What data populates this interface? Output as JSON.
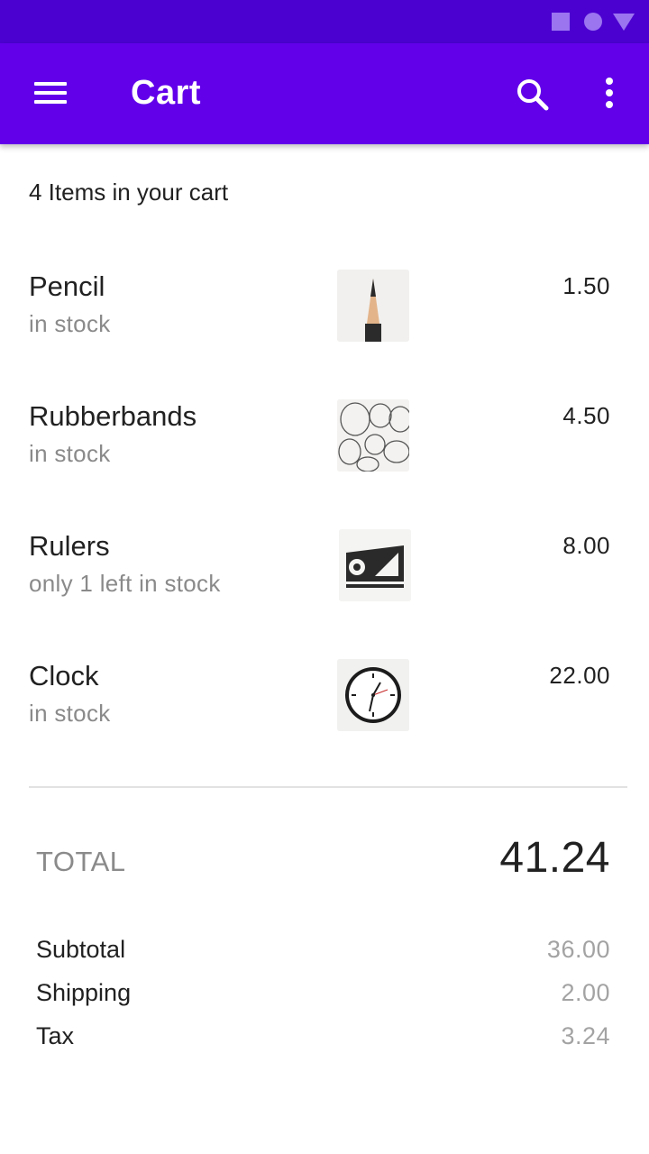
{
  "colors": {
    "status_bar": "#4b02d0",
    "app_bar": "#6200ea",
    "status_icons": "#9b74f0",
    "secondary_text": "#8a8a8a"
  },
  "app_bar": {
    "title": "Cart",
    "icons": [
      "menu-icon",
      "search-icon",
      "more-vert-icon"
    ]
  },
  "cart": {
    "count_text": "4 Items in your cart",
    "items": [
      {
        "name": "Pencil",
        "status": "in stock",
        "price": "1.50",
        "thumb": "pencil-image"
      },
      {
        "name": "Rubberbands",
        "status": "in stock",
        "price": "4.50",
        "thumb": "rubberbands-image"
      },
      {
        "name": "Rulers",
        "status": "only 1 left in stock",
        "price": "8.00",
        "thumb": "rulers-image"
      },
      {
        "name": "Clock",
        "status": "in stock",
        "price": "22.00",
        "thumb": "clock-image"
      }
    ]
  },
  "summary": {
    "total_label": "TOTAL",
    "total_value": "41.24",
    "rows": [
      {
        "label": "Subtotal",
        "value": "36.00"
      },
      {
        "label": "Shipping",
        "value": "2.00"
      },
      {
        "label": "Tax",
        "value": "3.24"
      }
    ]
  }
}
